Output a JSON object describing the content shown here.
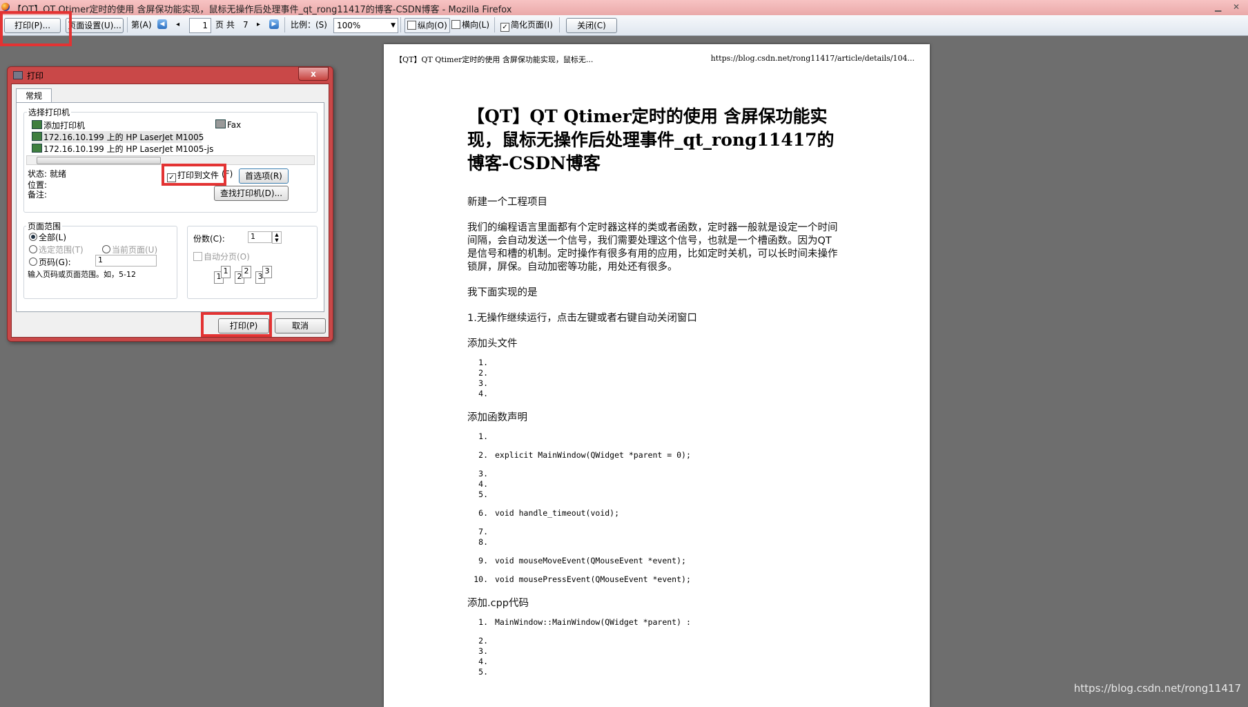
{
  "window": {
    "title": "【QT】QT Qtimer定时的使用 含屏保功能实现，鼠标无操作后处理事件_qt_rong11417的博客-CSDN博客 - Mozilla Firefox"
  },
  "toolbar": {
    "print_button": "打印(P)...",
    "page_setup_button": "页面设置(U)...",
    "page_label": "第(A)",
    "current_page": "1",
    "total_prefix": "页 共",
    "total_pages": "7",
    "scale_label": "比例：(S)",
    "scale_value": "100%",
    "portrait_label": "纵向(O)",
    "landscape_label": "横向(L)",
    "simplify_label": "简化页面(I)",
    "close_button": "关闭(C)"
  },
  "dialog": {
    "title": "打印",
    "close_glyph": "x",
    "tab_general": "常规",
    "select_printer_label": "选择打印机",
    "printers": [
      "添加打印机",
      "172.16.10.199 上的 HP LaserJet M1005",
      "172.16.10.199 上的 HP LaserJet M1005-js"
    ],
    "fax": "Fax",
    "status_label": "状态:",
    "status_value": "就绪",
    "location_label": "位置:",
    "comment_label": "备注:",
    "print_to_file": "打印到文件",
    "print_to_file_suffix": "(F)",
    "preferences_button": "首选项(R)",
    "find_printer_button": "查找打印机(D)...",
    "page_range_label": "页面范围",
    "range_all": "全部(L)",
    "range_selection": "选定范围(T)",
    "range_current": "当前页面(U)",
    "range_pages": "页码(G):",
    "range_pages_value": "1",
    "range_hint": "输入页码或页面范围。如，5-12",
    "copies_label": "份数(C):",
    "copies_value": "1",
    "collate_label": "自动分页(O)",
    "collate_numbers": [
      "1",
      "1",
      "2",
      "2",
      "3",
      "3"
    ],
    "print_button": "打印(P)",
    "cancel_button": "取消"
  },
  "page": {
    "header_left": "【QT】QT Qtimer定时的使用 含屏保功能实现，鼠标无...",
    "header_right": "https://blog.csdn.net/rong11417/article/details/104...",
    "title": "【QT】QT Qtimer定时的使用 含屏保功能实现，鼠标无操作后处理事件_qt_rong11417的博客-CSDN博客",
    "p1": "新建一个工程项目",
    "p2": "我们的编程语言里面都有个定时器这样的类或者函数，定时器一般就是设定一个时间间隔，会自动发送一个信号，我们需要处理这个信号，也就是一个槽函数。因为QT是信号和槽的机制。定时操作有很多有用的应用，比如定时关机，可以长时间未操作锁屏，屏保。自动加密等功能，用处还有很多。",
    "p3": "我下面实现的是",
    "p4": "1.无操作继续运行，点击左键或者右键自动关闭窗口",
    "p5": "添加头文件",
    "list1": [
      "1.",
      "2.",
      "3.",
      "4."
    ],
    "p6": "添加函数声明",
    "list2": [
      {
        "n": "1.",
        "t": ""
      },
      {
        "n": "2.",
        "t": "explicit MainWindow(QWidget *parent = 0);"
      },
      {
        "n": "3.",
        "t": ""
      },
      {
        "n": "4.",
        "t": ""
      },
      {
        "n": "5.",
        "t": ""
      },
      {
        "n": "6.",
        "t": "void handle_timeout(void);"
      },
      {
        "n": "7.",
        "t": ""
      },
      {
        "n": "8.",
        "t": ""
      },
      {
        "n": "9.",
        "t": "void mouseMoveEvent(QMouseEvent *event);"
      },
      {
        "n": "10.",
        "t": "void mousePressEvent(QMouseEvent *event);"
      }
    ],
    "p7": "添加.cpp代码",
    "list3": [
      {
        "n": "1.",
        "t": "MainWindow::MainWindow(QWidget *parent) :"
      },
      {
        "n": "2.",
        "t": ""
      },
      {
        "n": "3.",
        "t": ""
      },
      {
        "n": "4.",
        "t": ""
      },
      {
        "n": "5.",
        "t": ""
      }
    ]
  },
  "watermark": "https://blog.csdn.net/rong11417",
  "colors": {
    "highlight": "#e33333",
    "dialog_frame": "#c94848",
    "titlebar": "#f0b6b6"
  }
}
